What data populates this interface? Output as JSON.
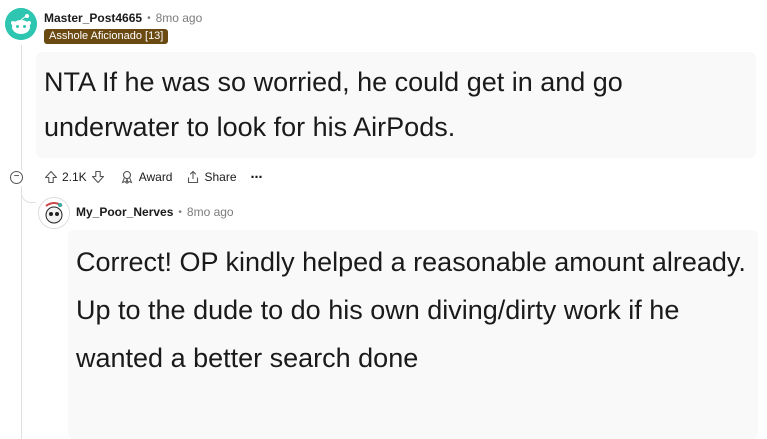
{
  "comment1": {
    "username": "Master_Post4665",
    "time": "8mo ago",
    "flair": "Asshole Aficionado [13]",
    "text": "NTA If he was so worried, he could get in and go underwater to look for his AirPods.",
    "avatar_color": "#2ec6b0"
  },
  "actions": {
    "upvote_count": "2.1K",
    "award_label": "Award",
    "share_label": "Share",
    "more_label": "⋯",
    "collapse_label": "−"
  },
  "comment2": {
    "username": "My_Poor_Nerves",
    "time": "8mo ago",
    "text": "Correct! OP kindly helped a reasonable amount already. Up to the dude to do his own diving/dirty work if he wanted a better search done"
  },
  "separator": "•",
  "colors": {
    "flair_bg": "#6b4a12",
    "meta_gray": "#7c7c7c"
  }
}
